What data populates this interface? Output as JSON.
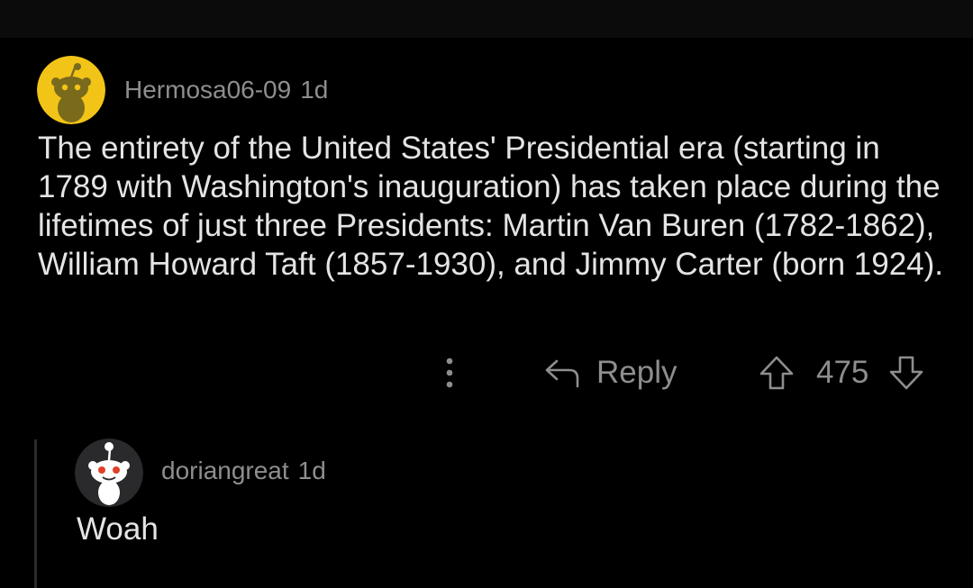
{
  "comments": [
    {
      "username": "Hermosa06-09",
      "age": "1d",
      "text": "The entirety of the United States' Presidential era (starting in 1789 with Washington's inauguration) has taken place during the lifetimes of just three Presidents: Martin Van Buren (1782-1862), William Howard Taft (1857-1930), and Jimmy Carter (born 1924).",
      "avatar_icon": "snoo-avatar-icon",
      "avatar_color": "#f2c418",
      "actions": {
        "more_icon": "more-vertical-icon",
        "reply_icon": "reply-arrow-icon",
        "reply_label": "Reply",
        "upvote_icon": "upvote-arrow-icon",
        "score": "475",
        "downvote_icon": "downvote-arrow-icon"
      }
    },
    {
      "username": "doriangreat",
      "age": "1d",
      "text": "Woah",
      "avatar_icon": "snoo-avatar-icon",
      "avatar_color": "#2a2a2c"
    }
  ],
  "colors": {
    "background": "#000000",
    "text": "#e4e4e6",
    "meta": "#8e8e90",
    "thread_line": "#2b2b2d"
  }
}
